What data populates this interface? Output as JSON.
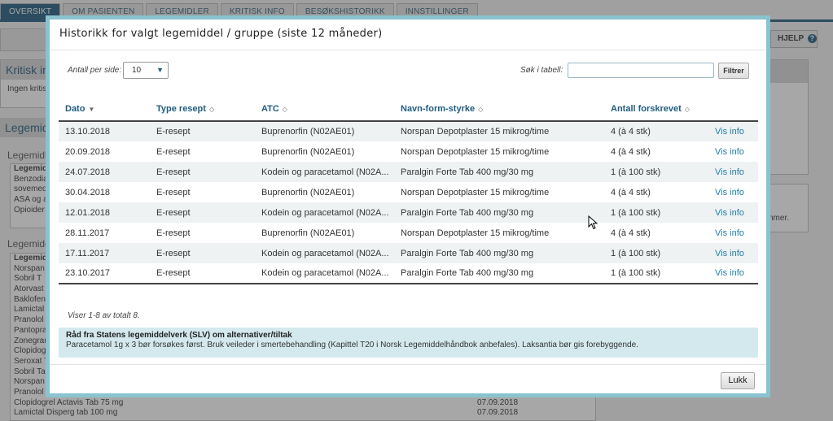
{
  "app": {
    "tabs": [
      {
        "label": "OVERSIKT",
        "active": true
      },
      {
        "label": "OM PASIENTEN",
        "active": false
      },
      {
        "label": "LEGEMIDLER",
        "active": false
      },
      {
        "label": "KRITISK INFO",
        "active": false
      },
      {
        "label": "BESØKSHISTORIKK",
        "active": false
      },
      {
        "label": "INNSTILLINGER",
        "active": false
      }
    ],
    "help_label": "HJELP",
    "help_icon": "question-circle-icon",
    "colors": {
      "accent": "#1f5c80",
      "modal_border": "#89c3cf",
      "link": "#1f7ea6",
      "advice_bg": "#d4e9ee"
    }
  },
  "background": {
    "critical_panel": {
      "title": "Kritisk in",
      "text": "Ingen kritisk"
    },
    "meds_heading": "Legemidl",
    "subhead_1": "Legemidle",
    "group_list": [
      "Legemid",
      "Benzodia",
      "sovemedi",
      "ASA og a",
      "Opioider"
    ],
    "subhead_2": "Legemidd",
    "med_list": [
      {
        "name": "Legemid",
        "date": ""
      },
      {
        "name": "Norspan",
        "date": ""
      },
      {
        "name": "Sobril T",
        "date": ""
      },
      {
        "name": "Atorvast",
        "date": ""
      },
      {
        "name": "Baklofen",
        "date": ""
      },
      {
        "name": "Lamictal",
        "date": ""
      },
      {
        "name": "Pranolol T",
        "date": ""
      },
      {
        "name": "Pantopra",
        "date": ""
      },
      {
        "name": "Zonegran",
        "date": ""
      },
      {
        "name": "Clopidog",
        "date": ""
      },
      {
        "name": "Seroxat T",
        "date": ""
      },
      {
        "name": "Sobril Tab",
        "date": ""
      },
      {
        "name": "Norspan D",
        "date": ""
      },
      {
        "name": "Pranolol T",
        "date": ""
      },
      {
        "name": "Clopidogrel Actavis Tab 75 mg",
        "date": "07.09.2018"
      },
      {
        "name": "Lamictal Disperg tab 100 mg",
        "date": "07.09.2018"
      }
    ],
    "right_panel_text": "nmer."
  },
  "modal": {
    "title": "Historikk for valgt legemiddel / gruppe (siste 12 måneder)",
    "per_page_label": "Antall per side:",
    "per_page_value": "10",
    "search_label": "Søk i tabell:",
    "search_value": "",
    "filter_label": "Filtrer",
    "columns": [
      "Dato",
      "Type resept",
      "ATC",
      "Navn-form-styrke",
      "Antall forskrevet"
    ],
    "rows": [
      {
        "dato": "13.10.2018",
        "type": "E-resept",
        "atc": "Buprenorfin (N02AE01)",
        "navn": "Norspan Depotplaster 15 mikrog/time",
        "antall": "4 (à 4 stk)",
        "link": "Vis info"
      },
      {
        "dato": "20.09.2018",
        "type": "E-resept",
        "atc": "Buprenorfin (N02AE01)",
        "navn": "Norspan Depotplaster 15 mikrog/time",
        "antall": "4 (à 4 stk)",
        "link": "Vis info"
      },
      {
        "dato": "24.07.2018",
        "type": "E-resept",
        "atc": "Kodein og paracetamol (N02A...",
        "navn": "Paralgin Forte Tab 400 mg/30 mg",
        "antall": "1 (à 100 stk)",
        "link": "Vis info"
      },
      {
        "dato": "30.04.2018",
        "type": "E-resept",
        "atc": "Buprenorfin (N02AE01)",
        "navn": "Norspan Depotplaster 15 mikrog/time",
        "antall": "4 (à 4 stk)",
        "link": "Vis info"
      },
      {
        "dato": "12.01.2018",
        "type": "E-resept",
        "atc": "Kodein og paracetamol (N02A...",
        "navn": "Paralgin Forte Tab 400 mg/30 mg",
        "antall": "1 (à 100 stk)",
        "link": "Vis info"
      },
      {
        "dato": "28.11.2017",
        "type": "E-resept",
        "atc": "Buprenorfin (N02AE01)",
        "navn": "Norspan Depotplaster 15 mikrog/time",
        "antall": "4 (à 4 stk)",
        "link": "Vis info"
      },
      {
        "dato": "17.11.2017",
        "type": "E-resept",
        "atc": "Kodein og paracetamol (N02A...",
        "navn": "Paralgin Forte Tab 400 mg/30 mg",
        "antall": "1 (à 100 stk)",
        "link": "Vis info"
      },
      {
        "dato": "23.10.2017",
        "type": "E-resept",
        "atc": "Kodein og paracetamol (N02A...",
        "navn": "Paralgin Forte Tab 400 mg/30 mg",
        "antall": "1 (à 100 stk)",
        "link": "Vis info"
      }
    ],
    "summary": "Viser 1-8 av totalt 8.",
    "advice_title": "Råd fra Statens legemiddelverk (SLV) om alternativer/tiltak",
    "advice_text": "Paracetamol 1g x 3 bør forsøkes først. Bruk veileder i smertebehandling (Kapittel T20 i Norsk Legemiddelhåndbok anbefales). Laksantia bør gis forebyggende.",
    "close_label": "Lukk"
  }
}
